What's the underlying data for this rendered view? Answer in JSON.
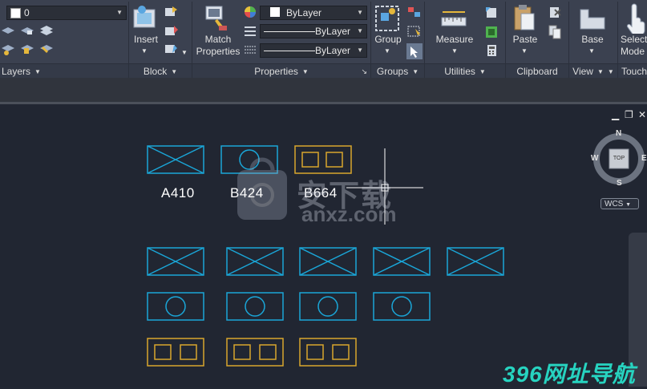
{
  "ribbon": {
    "layers": {
      "current_layer": "0",
      "panel_label": "Layers"
    },
    "block": {
      "insert_label": "Insert",
      "panel_label": "Block"
    },
    "properties": {
      "match_label_1": "Match",
      "match_label_2": "Properties",
      "color_value": "ByLayer",
      "linetype_value": "ByLayer",
      "lineweight_value": "ByLayer",
      "panel_label": "Properties"
    },
    "groups": {
      "group_label": "Group",
      "panel_label": "Groups"
    },
    "utilities": {
      "measure_label": "Measure",
      "panel_label": "Utilities"
    },
    "clipboard": {
      "paste_label": "Paste",
      "panel_label": "Clipboard"
    },
    "view": {
      "base_label": "Base",
      "panel_label": "View"
    },
    "touch": {
      "select_label_1": "Select",
      "select_label_2": "Mode",
      "panel_label": "Touch"
    }
  },
  "viewcube": {
    "top_label": "TOP",
    "north": "N",
    "south": "S",
    "east": "E",
    "west": "W",
    "wcs_label": "WCS"
  },
  "drawing": {
    "labels": [
      "A410",
      "B424",
      "B664"
    ]
  },
  "watermark": {
    "cn_text": "安下载",
    "url_text": "anxz.com",
    "bottom_text": "396网址导航"
  },
  "colors": {
    "cyan": "#1aa6d8",
    "gold": "#d9a62c",
    "ribbon_bg": "#3b4150",
    "canvas_bg": "#212632"
  }
}
